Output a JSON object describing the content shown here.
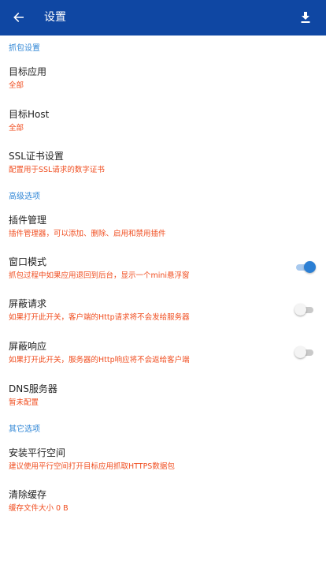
{
  "appbar": {
    "title": "设置",
    "back_icon": "arrow-left-icon",
    "download_icon": "download-icon"
  },
  "colors": {
    "appbar": "#0f47a3",
    "section_header": "#2f86d6",
    "summary": "#f04d1f",
    "switch_on": "#2b7fd4"
  },
  "sections": {
    "capture": {
      "header": "抓包设置"
    },
    "advanced": {
      "header": "高级选项"
    },
    "other": {
      "header": "其它选项"
    }
  },
  "items": {
    "target_app": {
      "label": "目标应用",
      "summary": "全部"
    },
    "target_host": {
      "label": "目标Host",
      "summary": "全部"
    },
    "ssl": {
      "label": "SSL证书设置",
      "summary": "配置用于SSL请求的数字证书"
    },
    "plugins": {
      "label": "插件管理",
      "summary": "插件管理器，可以添加、删除、启用和禁用插件"
    },
    "window_mode": {
      "label": "窗口模式",
      "summary": "抓包过程中如果应用退回到后台，显示一个mini悬浮窗",
      "enabled": true
    },
    "block_request": {
      "label": "屏蔽请求",
      "summary": "如果打开此开关，客户端的Http请求将不会发给服务器",
      "enabled": false
    },
    "block_response": {
      "label": "屏蔽响应",
      "summary": "如果打开此开关，服务器的Http响应将不会返给客户端",
      "enabled": false
    },
    "dns": {
      "label": "DNS服务器",
      "summary": "暂未配置"
    },
    "parallel_space": {
      "label": "安装平行空间",
      "summary": "建议使用平行空间打开目标应用抓取HTTPS数据包"
    },
    "clear_cache": {
      "label": "清除缓存",
      "summary": "缓存文件大小 0 B"
    }
  }
}
